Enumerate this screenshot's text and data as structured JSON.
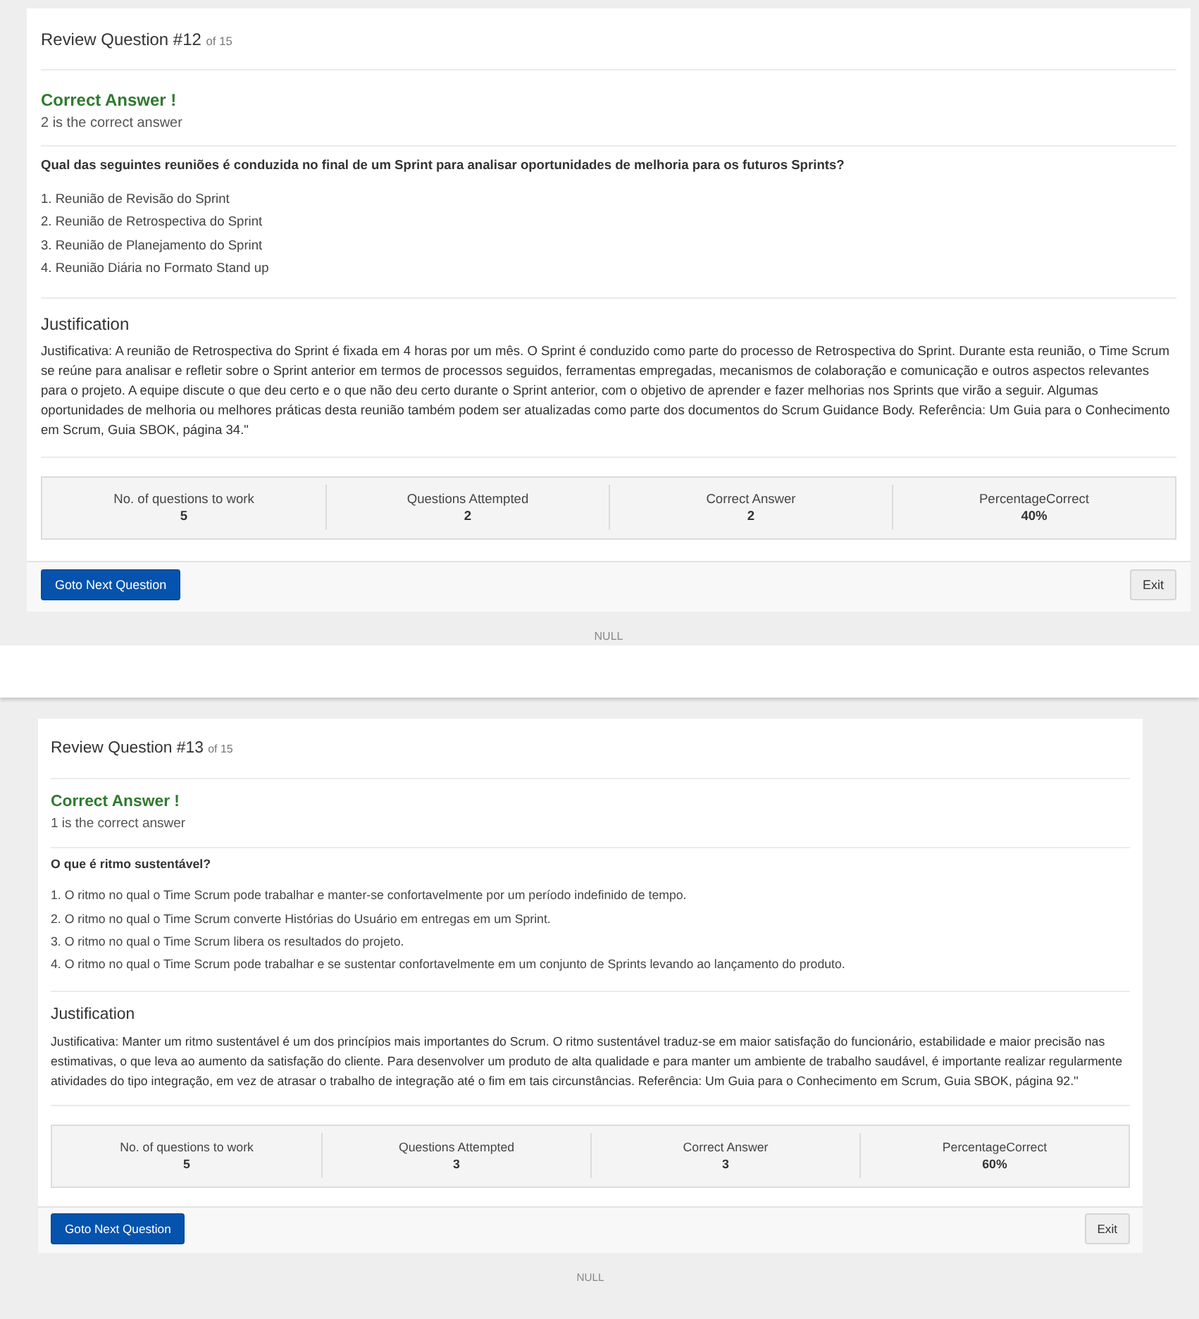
{
  "reviews": [
    {
      "title": "Review Question #12",
      "count": "of 15",
      "result": {
        "kind": "correct",
        "text": "Correct Answer !"
      },
      "correct_note": "2 is the correct answer",
      "question": "Qual das seguintes reuniões é conduzida no final de um Sprint para analisar oportunidades de melhoria para os futuros Sprints?",
      "options": [
        "1. Reunião de Revisão do Sprint",
        "2. Reunião de Retrospectiva do Sprint",
        "3. Reunião de Planejamento do Sprint",
        "4. Reunião Diária no Formato Stand up"
      ],
      "justification_heading": "Justification",
      "justification": "Justificativa: A reunião de Retrospectiva do Sprint é fixada em 4 horas por um mês. O Sprint é conduzido como parte do processo de Retrospectiva do Sprint. Durante esta reunião, o Time Scrum se reúne para analisar e refletir sobre o Sprint anterior em termos de processos seguidos, ferramentas empregadas, mecanismos de colaboração e comunicação e outros aspectos relevantes para o projeto. A equipe discute o que deu certo e o que não deu certo durante o Sprint anterior, com o objetivo de aprender e fazer melhorias nos Sprints que virão a seguir. Algumas oportunidades de melhoria ou melhores práticas desta reunião também podem ser atualizadas como parte dos documentos do Scrum Guidance Body. Referência: Um Guia para o Conhecimento em Scrum, Guia SBOK, página 34.\"",
      "stats": [
        {
          "label": "No. of questions to work",
          "value": "5"
        },
        {
          "label": "Questions Attempted",
          "value": "2"
        },
        {
          "label": "Correct Answer",
          "value": "2"
        },
        {
          "label": "PercentageCorrect",
          "value": "40%"
        }
      ],
      "buttons": [
        {
          "label": "Goto Next Question",
          "kind": "primary"
        },
        {
          "label": "Exit",
          "kind": "secondary"
        }
      ],
      "footer": "NULL"
    },
    {
      "title": "Review Question #13",
      "count": "of 15",
      "result": {
        "kind": "correct",
        "text": "Correct Answer !"
      },
      "correct_note": "1 is the correct answer",
      "question": "O que é ritmo sustentável?",
      "options": [
        "1. O ritmo no qual o Time Scrum pode trabalhar e manter-se confortavelmente por um período indefinido de tempo.",
        "2. O ritmo no qual o Time Scrum converte Histórias do Usuário em entregas em um Sprint.",
        "3. O ritmo no qual o Time Scrum libera os resultados do projeto.",
        "4. O ritmo no qual o Time Scrum pode trabalhar e se sustentar confortavelmente em um conjunto de Sprints levando ao lançamento do produto."
      ],
      "justification_heading": "Justification",
      "justification": "Justificativa: Manter um ritmo sustentável é um dos princípios mais importantes do Scrum. O ritmo sustentável traduz-se em maior satisfação do funcionário, estabilidade e maior precisão nas estimativas, o que leva ao aumento da satisfação do cliente. Para desenvolver um produto de alta qualidade e para manter um ambiente de trabalho saudável, é importante realizar regularmente atividades do tipo integração, em vez de atrasar o trabalho de integração até o fim em tais circunstâncias. Referência: Um Guia para o Conhecimento em Scrum, Guia SBOK, página 92.''",
      "stats": [
        {
          "label": "No. of questions to work",
          "value": "5"
        },
        {
          "label": "Questions Attempted",
          "value": "3"
        },
        {
          "label": "Correct Answer",
          "value": "3"
        },
        {
          "label": "PercentageCorrect",
          "value": "60%"
        }
      ],
      "buttons": [
        {
          "label": "Goto Next Question",
          "kind": "primary"
        },
        {
          "label": "Exit",
          "kind": "secondary"
        }
      ],
      "footer": "NULL"
    }
  ]
}
